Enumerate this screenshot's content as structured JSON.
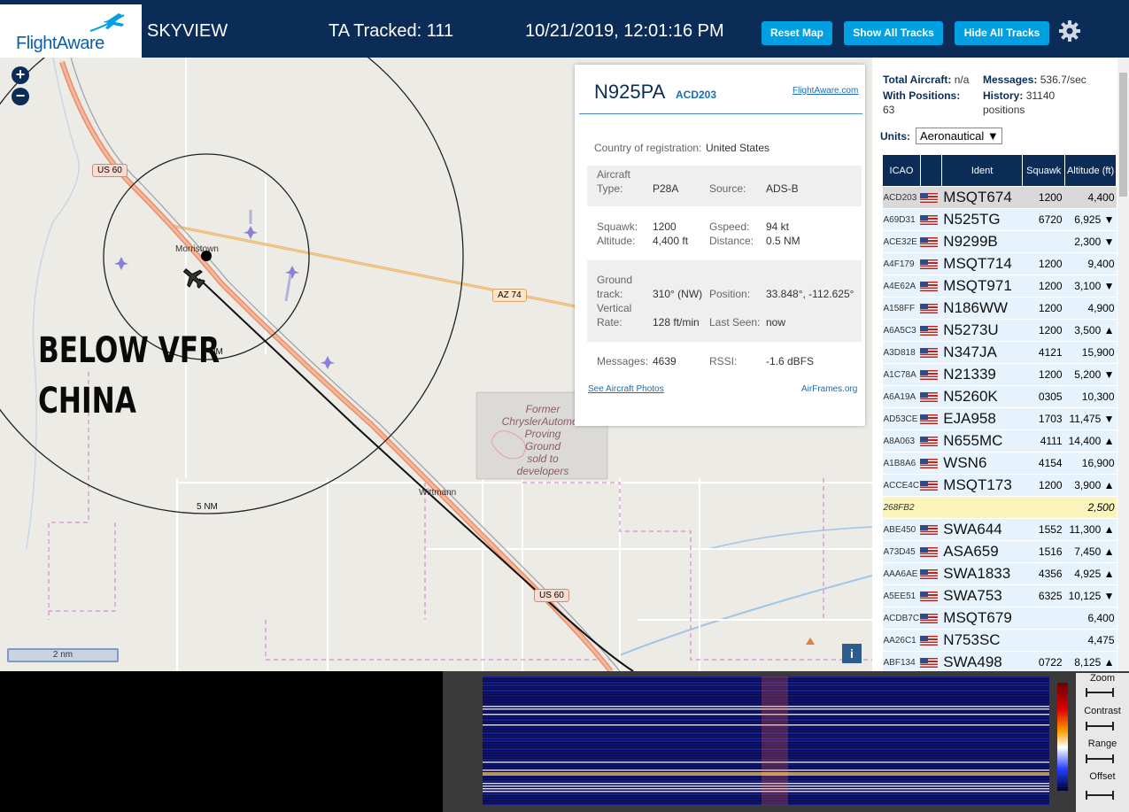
{
  "header": {
    "brand": "FlightAware",
    "app_name": "SKYVIEW",
    "ta_tracked": "TA Tracked: 111",
    "datetime": "10/21/2019, 12:01:16 PM",
    "buttons": {
      "reset_map": "Reset Map",
      "show_all": "Show All Tracks",
      "hide_all": "Hide All Tracks"
    }
  },
  "map": {
    "zoom_in": "+",
    "zoom_out": "−",
    "scale_label": "2 nm",
    "info": "i",
    "overlay_line1": "BELOW VFR",
    "overlay_line2": "CHINA",
    "labels": {
      "us60_top": "US 60",
      "us60_bottom": "US 60",
      "az74": "AZ 74",
      "morristown": "Morristown",
      "wittmann": "Wittmann",
      "ring_5nm": "5 NM",
      "ring_inner": "2 NM",
      "chrysler_1": "Former",
      "chrysler_2": "ChryslerAutomob",
      "chrysler_3": "Proving",
      "chrysler_4": "Ground",
      "chrysler_5": "sold to",
      "chrysler_6": "developers"
    }
  },
  "popup": {
    "callsign": "N925PA",
    "icao": "ACD203",
    "flightaware_link": "FlightAware.com",
    "country_label": "Country of registration:",
    "country_value": "United States",
    "aircraft_type_label_1": "Aircraft",
    "aircraft_type_label_2": "Type:",
    "aircraft_type": "P28A",
    "source_label": "Source:",
    "source": "ADS-B",
    "squawk_label": "Squawk:",
    "squawk": "1200",
    "gspeed_label": "Gspeed:",
    "gspeed": "94 kt",
    "altitude_label": "Altitude:",
    "altitude": "4,400 ft",
    "distance_label": "Distance:",
    "distance": "0.5 NM",
    "track_label_1": "Ground",
    "track_label_2": "track:",
    "track": "310° (NW)",
    "position_label": "Position:",
    "position": "33.848°, -112.625°",
    "vrate_label_1": "Vertical",
    "vrate_label_2": "Rate:",
    "vrate": "128 ft/min",
    "lastseen_label": "Last Seen:",
    "lastseen": "now",
    "messages_label": "Messages:",
    "messages": "4639",
    "rssi_label": "RSSI:",
    "rssi": "-1.6 dBFS",
    "photos_link": "See Aircraft Photos",
    "airframes_link": "AirFrames.org"
  },
  "sidebar": {
    "total_label": "Total Aircraft:",
    "total_value": "n/a",
    "messages_label": "Messages:",
    "messages_value": "536.7/sec",
    "withpos_label": "With Positions:",
    "withpos_value": "63",
    "history_label": "History:",
    "history_value_1": "31140",
    "history_value_2": "positions",
    "units_label": "Units:",
    "units_value": "Aeronautical ▼",
    "columns": [
      "ICAO",
      "Ident",
      "Squawk",
      "Altitude (ft)"
    ],
    "rows": [
      {
        "icao": "ACD203",
        "flag": true,
        "ident": "MSQT674",
        "squawk": "1200",
        "alt": "4,400"
      },
      {
        "icao": "A69D31",
        "flag": true,
        "ident": "N525TG",
        "squawk": "6720",
        "alt": "6,925 ▼"
      },
      {
        "icao": "ACE32E",
        "flag": true,
        "ident": "N9299B",
        "squawk": "",
        "alt": "2,300 ▼"
      },
      {
        "icao": "A4F179",
        "flag": true,
        "ident": "MSQT714",
        "squawk": "1200",
        "alt": "9,400"
      },
      {
        "icao": "A4E62A",
        "flag": true,
        "ident": "MSQT971",
        "squawk": "1200",
        "alt": "3,100 ▼"
      },
      {
        "icao": "A158FF",
        "flag": true,
        "ident": "N186WW",
        "squawk": "1200",
        "alt": "4,900"
      },
      {
        "icao": "A6A5C3",
        "flag": true,
        "ident": "N5273U",
        "squawk": "1200",
        "alt": "3,500 ▲"
      },
      {
        "icao": "A3D818",
        "flag": true,
        "ident": "N347JA",
        "squawk": "4121",
        "alt": "15,900"
      },
      {
        "icao": "A1C78A",
        "flag": true,
        "ident": "N21339",
        "squawk": "1200",
        "alt": "5,200 ▼"
      },
      {
        "icao": "A6A19A",
        "flag": true,
        "ident": "N5260K",
        "squawk": "0305",
        "alt": "10,300"
      },
      {
        "icao": "AD53CE",
        "flag": true,
        "ident": "EJA958",
        "squawk": "1703",
        "alt": "11,475 ▼"
      },
      {
        "icao": "A8A063",
        "flag": true,
        "ident": "N655MC",
        "squawk": "4111",
        "alt": "14,400 ▲"
      },
      {
        "icao": "A1B8A6",
        "flag": true,
        "ident": "WSN6",
        "squawk": "4154",
        "alt": "16,900"
      },
      {
        "icao": "ACCE4C",
        "flag": true,
        "ident": "MSQT173",
        "squawk": "1200",
        "alt": "3,900 ▲"
      },
      {
        "icao": "268FB2",
        "flag": false,
        "ident": "",
        "squawk": "",
        "alt": "2,500"
      },
      {
        "icao": "ABE450",
        "flag": true,
        "ident": "SWA644",
        "squawk": "1552",
        "alt": "11,300 ▲"
      },
      {
        "icao": "A73D45",
        "flag": true,
        "ident": "ASA659",
        "squawk": "1516",
        "alt": "7,450 ▲"
      },
      {
        "icao": "AAA6AE",
        "flag": true,
        "ident": "SWA1833",
        "squawk": "4356",
        "alt": "4,925 ▲"
      },
      {
        "icao": "A5EE51",
        "flag": true,
        "ident": "SWA753",
        "squawk": "6325",
        "alt": "10,125 ▼"
      },
      {
        "icao": "ACDB7C",
        "flag": true,
        "ident": "MSQT679",
        "squawk": "",
        "alt": "6,400"
      },
      {
        "icao": "AA26C1",
        "flag": true,
        "ident": "N753SC",
        "squawk": "",
        "alt": "4,475"
      },
      {
        "icao": "ABF134",
        "flag": true,
        "ident": "SWA498",
        "squawk": "0722",
        "alt": "8,125 ▲"
      }
    ]
  },
  "waterfall_controls": {
    "zoom": "Zoom",
    "contrast": "Contrast",
    "range": "Range",
    "offset": "Offset"
  },
  "colors": {
    "header_bg": "#0a2c57",
    "button_bg": "#00a0e3",
    "row_bg": "#e6f3fd",
    "selected_row": "#d9d9d9",
    "highlight_row": "#fbf4bd"
  }
}
